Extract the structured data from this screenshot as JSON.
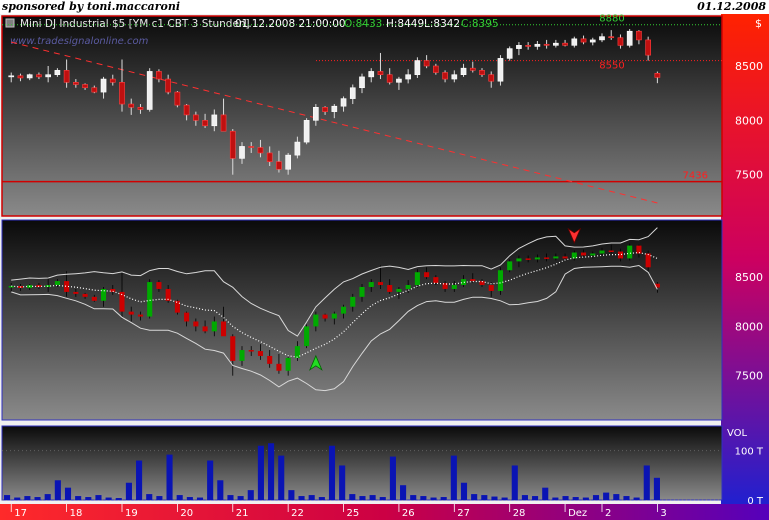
{
  "header": {
    "sponsor": "sponsored by toni.maccaroni",
    "date": "01.12.2008"
  },
  "symbol_line": {
    "name": "Mini DJ Industrial $5 [YM c1 CBT  3 Stunden]",
    "timestamp": "01.12.2008 21:00:00",
    "o": "O:8433",
    "h": "H:8449",
    "l": "L:8342",
    "c": "C:8395"
  },
  "watermark": "www.tradesignalonline.com",
  "currency_symbol": "$",
  "colors": {
    "up": "#00aa00",
    "down": "#cc0000",
    "volume": "#0a14b4",
    "level_green": "#33cc33",
    "level_red": "#ff2020",
    "frame": "#d00000"
  },
  "chart_data": {
    "type": "candlestick",
    "price_axis": {
      "ticks": [
        7500,
        8000,
        8500
      ],
      "labels": [
        "7500",
        "8000",
        "8500"
      ],
      "ylim": [
        7120,
        8960
      ]
    },
    "indicator_axis": {
      "ticks": [
        7500,
        8000,
        8500
      ],
      "labels": [
        "7500",
        "8000",
        "8500"
      ],
      "ylim": [
        7050,
        9080
      ]
    },
    "volume_axis": {
      "title": "VOL",
      "ticks": [
        0,
        100
      ],
      "labels": [
        "0 T",
        "100 T"
      ],
      "ylim": [
        0,
        150
      ]
    },
    "x_axis": {
      "labels": [
        "17",
        "18",
        "19",
        "20",
        "21",
        "22",
        "25",
        "26",
        "27",
        "28",
        "Dez",
        "2",
        "3"
      ],
      "positions": [
        0,
        6,
        12,
        18,
        24,
        30,
        36,
        42,
        48,
        54,
        60,
        64,
        70
      ],
      "xlim": [
        -1,
        77
      ]
    },
    "levels": [
      {
        "label": "8880",
        "value": 8880,
        "color": "green"
      },
      {
        "label": "8550",
        "value": 8550,
        "color": "red"
      },
      {
        "label": "7436",
        "value": 7436,
        "color": "red"
      }
    ],
    "trendline": {
      "from": [
        0,
        8720
      ],
      "to": [
        70,
        7240
      ]
    },
    "arrows": [
      {
        "type": "buy",
        "bar": 33,
        "value": 7600
      },
      {
        "type": "sell",
        "bar": 61,
        "value": 8950
      }
    ],
    "candles": [
      [
        8400,
        8440,
        8350,
        8410
      ],
      [
        8410,
        8430,
        8360,
        8390
      ],
      [
        8390,
        8430,
        8370,
        8420
      ],
      [
        8420,
        8440,
        8380,
        8400
      ],
      [
        8400,
        8500,
        8350,
        8420
      ],
      [
        8420,
        8480,
        8400,
        8460
      ],
      [
        8460,
        8560,
        8300,
        8350
      ],
      [
        8350,
        8380,
        8300,
        8330
      ],
      [
        8330,
        8340,
        8280,
        8300
      ],
      [
        8300,
        8320,
        8250,
        8260
      ],
      [
        8260,
        8400,
        8200,
        8380
      ],
      [
        8380,
        8420,
        8320,
        8350
      ],
      [
        8350,
        8560,
        8080,
        8150
      ],
      [
        8150,
        8200,
        8050,
        8120
      ],
      [
        8120,
        8150,
        8060,
        8100
      ],
      [
        8100,
        8480,
        8080,
        8450
      ],
      [
        8450,
        8470,
        8350,
        8380
      ],
      [
        8380,
        8420,
        8240,
        8260
      ],
      [
        8260,
        8270,
        8120,
        8140
      ],
      [
        8140,
        8150,
        8000,
        8050
      ],
      [
        8050,
        8080,
        7950,
        8000
      ],
      [
        8000,
        8060,
        7930,
        7950
      ],
      [
        7950,
        8100,
        7900,
        8050
      ],
      [
        8050,
        8200,
        7950,
        7900
      ],
      [
        7900,
        7920,
        7500,
        7650
      ],
      [
        7650,
        7800,
        7600,
        7760
      ],
      [
        7760,
        7800,
        7700,
        7750
      ],
      [
        7750,
        7820,
        7660,
        7700
      ],
      [
        7700,
        7760,
        7580,
        7620
      ],
      [
        7620,
        7720,
        7520,
        7550
      ],
      [
        7550,
        7700,
        7500,
        7680
      ],
      [
        7680,
        7850,
        7650,
        7800
      ],
      [
        7800,
        8020,
        7780,
        8000
      ],
      [
        8000,
        8150,
        7950,
        8120
      ],
      [
        8120,
        8130,
        8050,
        8080
      ],
      [
        8080,
        8150,
        8020,
        8130
      ],
      [
        8130,
        8220,
        8080,
        8200
      ],
      [
        8200,
        8330,
        8150,
        8300
      ],
      [
        8300,
        8430,
        8250,
        8400
      ],
      [
        8400,
        8480,
        8350,
        8450
      ],
      [
        8450,
        8620,
        8380,
        8420
      ],
      [
        8420,
        8480,
        8330,
        8350
      ],
      [
        8350,
        8400,
        8280,
        8380
      ],
      [
        8380,
        8470,
        8340,
        8420
      ],
      [
        8420,
        8580,
        8390,
        8550
      ],
      [
        8550,
        8600,
        8480,
        8500
      ],
      [
        8500,
        8520,
        8420,
        8440
      ],
      [
        8440,
        8460,
        8350,
        8380
      ],
      [
        8380,
        8460,
        8350,
        8420
      ],
      [
        8420,
        8520,
        8400,
        8480
      ],
      [
        8480,
        8540,
        8440,
        8460
      ],
      [
        8460,
        8480,
        8400,
        8420
      ],
      [
        8420,
        8450,
        8300,
        8360
      ],
      [
        8360,
        8600,
        8320,
        8570
      ],
      [
        8570,
        8680,
        8550,
        8660
      ],
      [
        8660,
        8720,
        8600,
        8690
      ],
      [
        8690,
        8720,
        8650,
        8680
      ],
      [
        8680,
        8730,
        8650,
        8700
      ],
      [
        8700,
        8740,
        8660,
        8690
      ],
      [
        8690,
        8740,
        8670,
        8710
      ],
      [
        8710,
        8740,
        8680,
        8690
      ],
      [
        8690,
        8770,
        8670,
        8750
      ],
      [
        8750,
        8780,
        8700,
        8720
      ],
      [
        8720,
        8760,
        8690,
        8740
      ],
      [
        8740,
        8800,
        8720,
        8770
      ],
      [
        8770,
        8830,
        8740,
        8760
      ],
      [
        8760,
        8790,
        8660,
        8690
      ],
      [
        8690,
        8840,
        8670,
        8820
      ],
      [
        8820,
        8830,
        8700,
        8740
      ],
      [
        8740,
        8770,
        8550,
        8600
      ],
      [
        8433,
        8449,
        8342,
        8395
      ]
    ],
    "volume": [
      10,
      5,
      8,
      6,
      12,
      40,
      25,
      8,
      6,
      10,
      5,
      4,
      35,
      80,
      12,
      8,
      92,
      10,
      6,
      5,
      80,
      40,
      10,
      8,
      20,
      110,
      115,
      90,
      20,
      8,
      10,
      6,
      110,
      70,
      12,
      8,
      10,
      6,
      88,
      30,
      10,
      8,
      5,
      6,
      90,
      35,
      12,
      10,
      7,
      5,
      70,
      10,
      8,
      25,
      5,
      8,
      6,
      5,
      10,
      15,
      12,
      8,
      5,
      70,
      45
    ]
  }
}
